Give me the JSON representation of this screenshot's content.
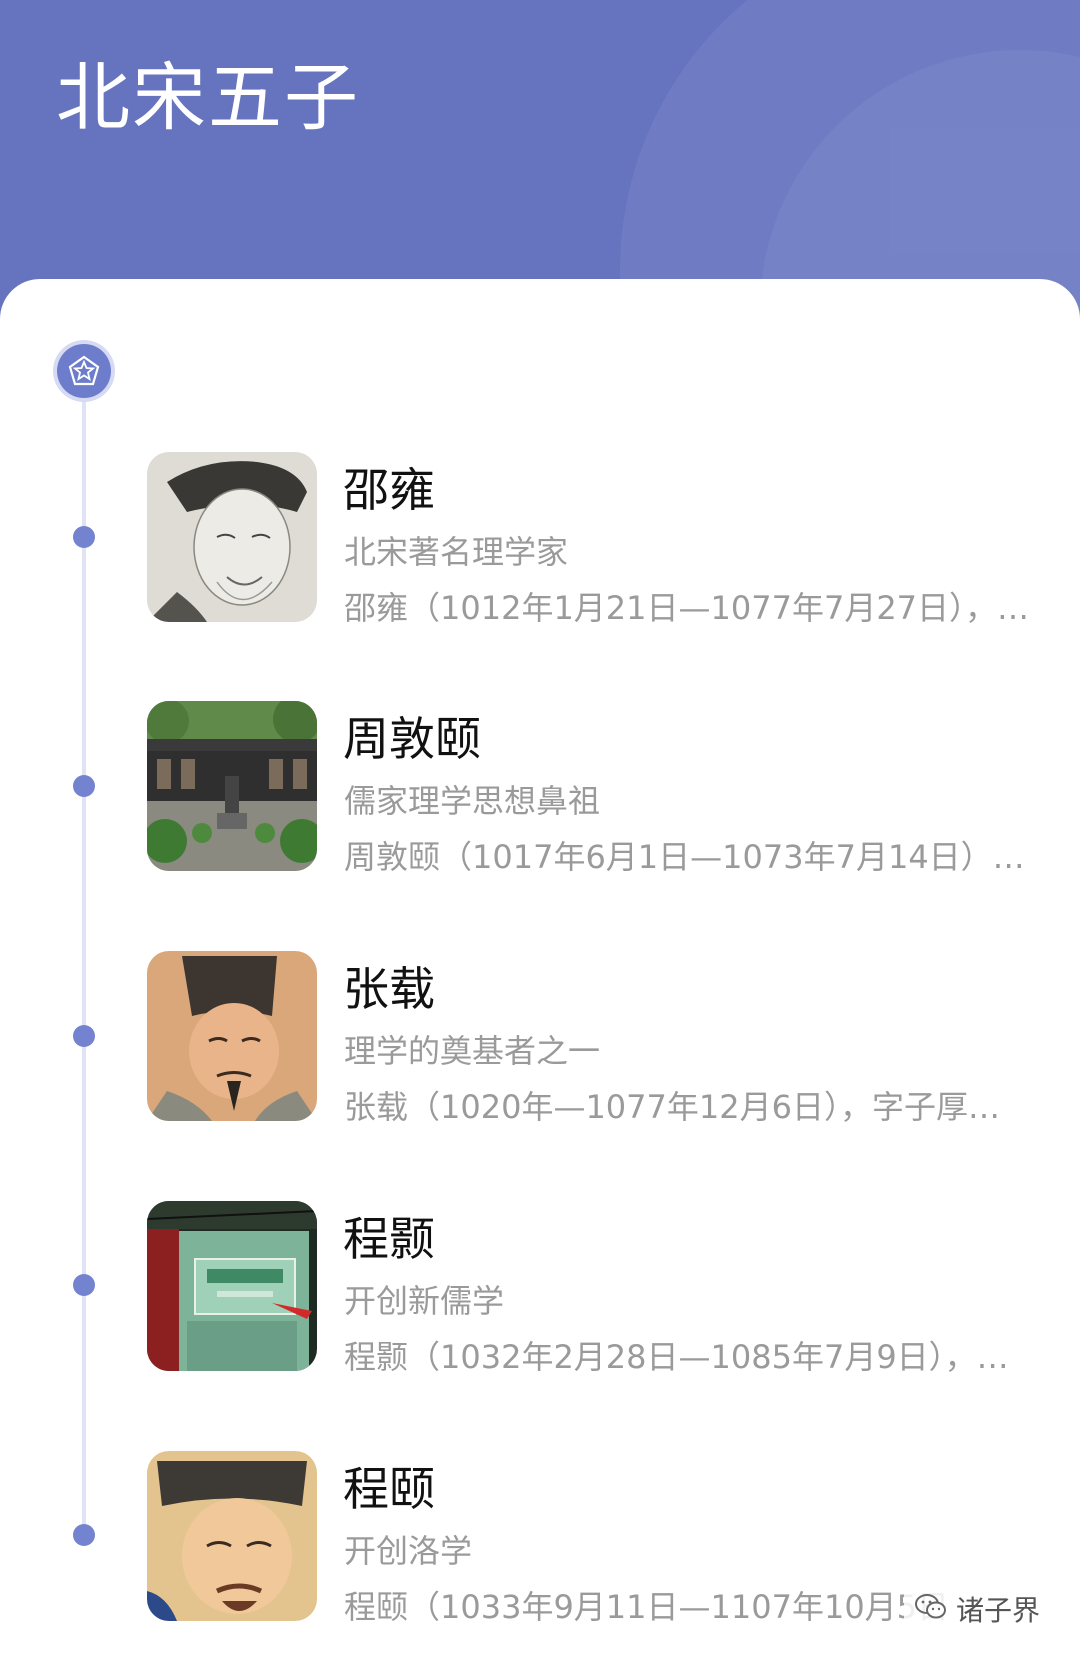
{
  "page": {
    "title": "北宋五子"
  },
  "colors": {
    "header_bg": "#6674c0",
    "accent": "#7483d0",
    "timeline": "#e0e3f3",
    "name_text": "#111111",
    "secondary_text": "#9a9a9a"
  },
  "timeline": {
    "head_icon": "pentagon-star-icon"
  },
  "items": [
    {
      "name": "邵雍",
      "subtitle": "北宋著名理学家",
      "desc": "邵雍（1012年1月21日—1077年7月27日），…",
      "thumb": "portrait-shao-yong"
    },
    {
      "name": "周敦颐",
      "subtitle": "儒家理学思想鼻祖",
      "desc": "周敦颐（1017年6月1日—1073年7月14日）…",
      "thumb": "memorial-hall-photo"
    },
    {
      "name": "张载",
      "subtitle": "理学的奠基者之一",
      "desc": "张载（1020年—1077年12月6日），字子厚…",
      "thumb": "portrait-zhang-zai"
    },
    {
      "name": "程颢",
      "subtitle": "开创新儒学",
      "desc": "程颢（1032年2月28日—1085年7月9日），…",
      "thumb": "gate-plaque-photo"
    },
    {
      "name": "程颐",
      "subtitle": "开创洛学",
      "desc": "程颐（1033年9月11日—1107年10月5日",
      "thumb": "portrait-cheng-yi"
    }
  ],
  "watermark": {
    "text": "诸子界",
    "icon": "wechat-icon"
  }
}
